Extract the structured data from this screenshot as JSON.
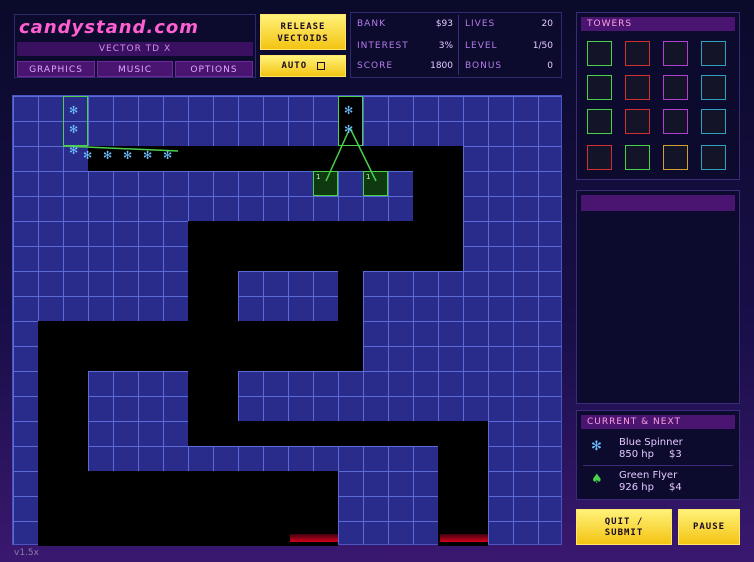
{
  "header": {
    "logo": "CANDYSTAND.com",
    "subtitle": "VECTOR TD X",
    "menu": [
      "GRAPHICS",
      "MUSIC",
      "OPTIONS"
    ],
    "release_label_1": "RELEASE",
    "release_label_2": "VECTOIDS",
    "auto_label": "AUTO"
  },
  "stats": {
    "bank_label": "BANK",
    "bank": "$93",
    "interest_label": "INTEREST",
    "interest": "3%",
    "score_label": "SCORE",
    "score": "1800",
    "lives_label": "LIVES",
    "lives": "20",
    "level_label": "LEVEL",
    "level": "1/50",
    "bonus_label": "BONUS",
    "bonus": "0"
  },
  "towers_panel": {
    "title": "TOWERS"
  },
  "current_next": {
    "title": "CURRENT & NEXT",
    "current": {
      "name": "Blue Spinner",
      "hp": "850 hp",
      "reward": "$3"
    },
    "next": {
      "name": "Green Flyer",
      "hp": "926 hp",
      "reward": "$4"
    }
  },
  "buttons": {
    "quit_1": "QUIT /",
    "quit_2": "SUBMIT",
    "pause": "PAUSE"
  },
  "version": "v1.5x",
  "tower_labels": [
    "1",
    "1"
  ]
}
